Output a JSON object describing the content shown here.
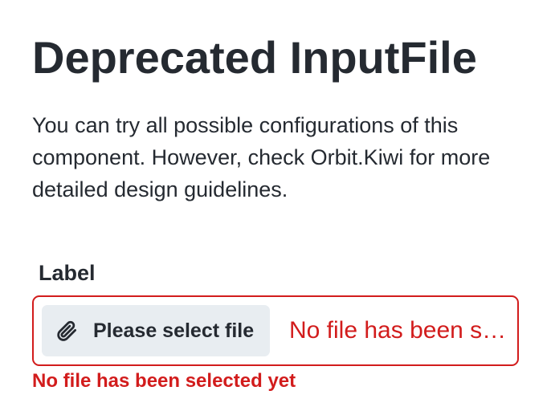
{
  "page": {
    "title": "Deprecated InputFile",
    "description": "You can try all possible configurations of this component. However, check Orbit.Kiwi for more detailed design guidelines."
  },
  "input_file": {
    "label": "Label",
    "button_label": "Please select file",
    "button_icon": "paperclip-icon",
    "status_text": "No file has been selected yet",
    "error": "No file has been selected yet"
  },
  "colors": {
    "text": "#252a31",
    "error": "#d21c1c",
    "button_bg": "#e8edf1"
  }
}
